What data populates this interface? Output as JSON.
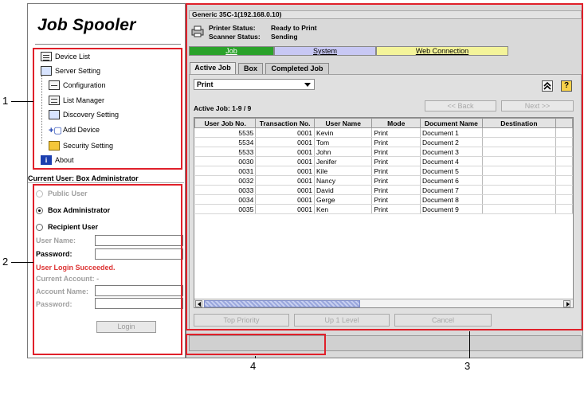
{
  "callouts": [
    "1",
    "2",
    "3",
    "4"
  ],
  "left_panel": {
    "app_title": "Job Spooler",
    "tree": [
      {
        "label": "Device List",
        "icon": "list-icon"
      },
      {
        "label": "Server Setting",
        "icon": "server-icon"
      },
      {
        "label": "Configuration",
        "icon": "configuration-icon"
      },
      {
        "label": "List Manager",
        "icon": "list-manager-icon"
      },
      {
        "label": "Discovery Setting",
        "icon": "magnifier-icon"
      },
      {
        "label": "Add Device",
        "icon": "add-device-icon"
      },
      {
        "label": "Security Setting",
        "icon": "lock-icon"
      },
      {
        "label": "About",
        "icon": "info-icon"
      }
    ],
    "current_user": "Current User: Box Administrator",
    "roles": [
      {
        "label": "Public User",
        "selected": false,
        "disabled": true
      },
      {
        "label": "Box Administrator",
        "selected": true,
        "disabled": false
      },
      {
        "label": "Recipient User",
        "selected": false,
        "disabled": false
      }
    ],
    "user_name_label": "User Name:",
    "password_label": "Password:",
    "login_message": "User Login Succeeded.",
    "current_account": "Current Account: -",
    "account_name_label": "Account Name:",
    "account_password_label": "Password:",
    "login_button": "Login"
  },
  "right_panel": {
    "device_title": "Generic 35C-1(192.168.0.10)",
    "printer_status_label": "Printer Status:",
    "printer_status_value": "Ready to Print",
    "scanner_status_label": "Scanner Status:",
    "scanner_status_value": "Sending",
    "nav_tabs": [
      {
        "label": "Job",
        "color": "#2aa22a"
      },
      {
        "label": "System",
        "color": "#c8c8f4"
      },
      {
        "label": "Web Connection",
        "color": "#f4f49a"
      }
    ],
    "sub_tabs": [
      "Active Job",
      "Box",
      "Completed Job"
    ],
    "job_filter": "Print",
    "active_job_count": "Active Job: 1-9 / 9",
    "back_button": "<< Back",
    "next_button": "Next >>",
    "columns": [
      "User Job No.",
      "Transaction No.",
      "User Name",
      "Mode",
      "Document Name",
      "Destination"
    ],
    "rows": [
      [
        "5535",
        "0001",
        "Kevin",
        "Print",
        "Document 1",
        ""
      ],
      [
        "5534",
        "0001",
        "Tom",
        "Print",
        "Document 2",
        ""
      ],
      [
        "5533",
        "0001",
        "John",
        "Print",
        "Document 3",
        ""
      ],
      [
        "0030",
        "0001",
        "Jenifer",
        "Print",
        "Document 4",
        ""
      ],
      [
        "0031",
        "0001",
        "Kile",
        "Print",
        "Document 5",
        ""
      ],
      [
        "0032",
        "0001",
        "Nancy",
        "Print",
        "Document 6",
        ""
      ],
      [
        "0033",
        "0001",
        "David",
        "Print",
        "Document 7",
        ""
      ],
      [
        "0034",
        "0001",
        "Gerge",
        "Print",
        "Document 8",
        ""
      ],
      [
        "0035",
        "0001",
        "Ken",
        "Print",
        "Document 9",
        ""
      ]
    ],
    "top_priority_button": "Top Priority",
    "up_level_button": "Up 1 Level",
    "cancel_button": "Cancel"
  },
  "colors": {
    "annotation_red": "#e0202a",
    "job_tab": "#2aa22a",
    "system_tab": "#c8c8f4",
    "web_tab": "#f4f49a",
    "success_text": "#d33333"
  }
}
